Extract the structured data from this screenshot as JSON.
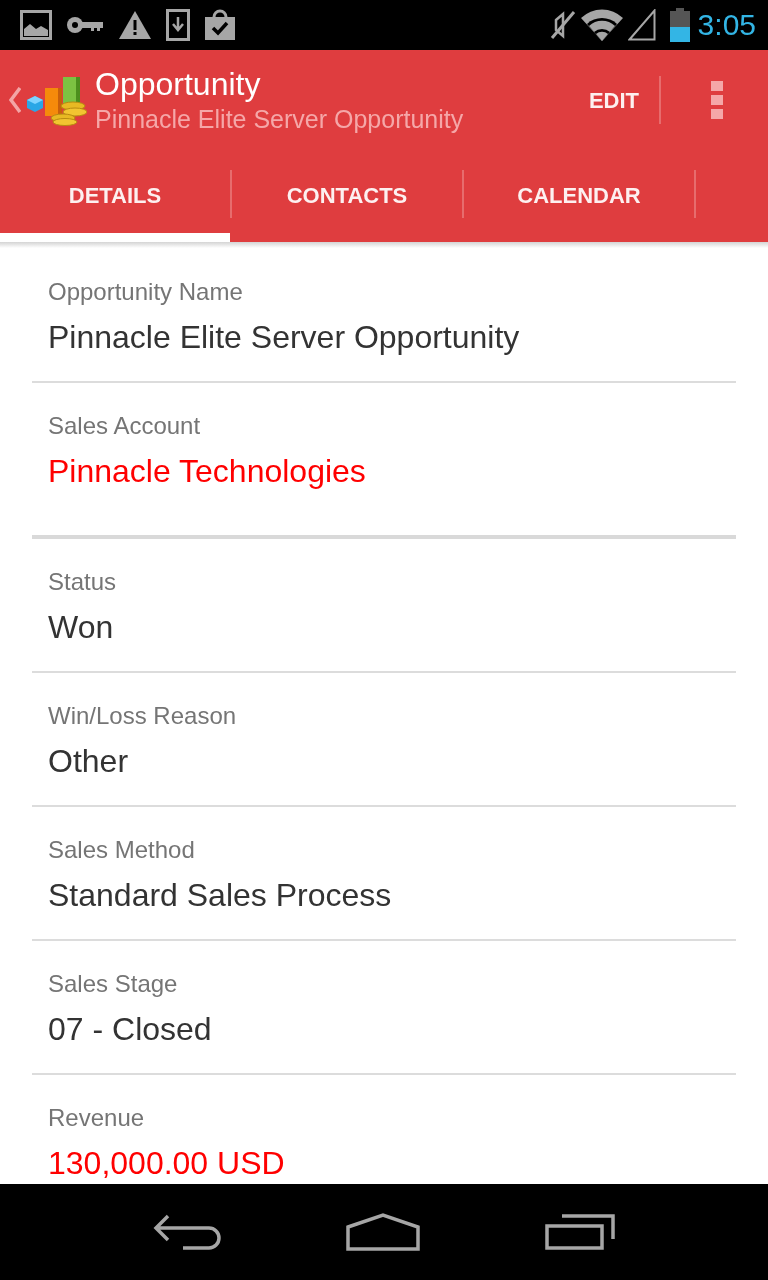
{
  "status_bar": {
    "time": "3:05"
  },
  "action_bar": {
    "title": "Opportunity",
    "subtitle": "Pinnacle Elite Server Opportunity",
    "action": "EDIT"
  },
  "tabs": [
    {
      "label": "DETAILS",
      "selected": true
    },
    {
      "label": "CONTACTS",
      "selected": false
    },
    {
      "label": "CALENDAR",
      "selected": false
    }
  ],
  "sections": [
    {
      "fields": [
        {
          "label": "Opportunity Name",
          "value": "Pinnacle Elite Server Opportunity",
          "kind": "text"
        },
        {
          "label": "Sales Account",
          "value": "Pinnacle Technologies",
          "kind": "link"
        }
      ]
    },
    {
      "fields": [
        {
          "label": "Status",
          "value": "Won",
          "kind": "text"
        },
        {
          "label": "Win/Loss Reason",
          "value": "Other",
          "kind": "text"
        },
        {
          "label": "Sales Method",
          "value": "Standard Sales Process",
          "kind": "text"
        },
        {
          "label": "Sales Stage",
          "value": "07 - Closed",
          "kind": "text"
        },
        {
          "label": "Revenue",
          "value": "130,000.00 USD",
          "kind": "link"
        }
      ]
    }
  ]
}
